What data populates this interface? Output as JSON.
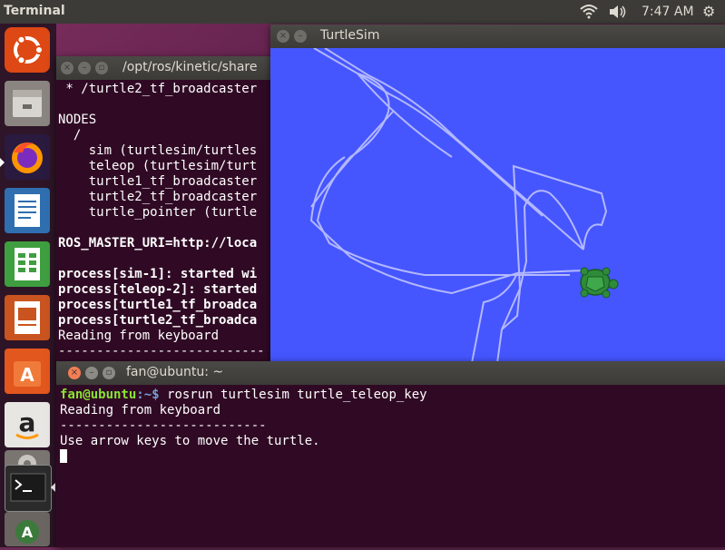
{
  "top_panel": {
    "app_title": "Terminal",
    "time": "7:47 AM",
    "indicators": [
      "wifi-icon",
      "volume-icon",
      "gear-icon"
    ]
  },
  "launcher": {
    "items": [
      "ubuntu-dash-icon",
      "files-icon",
      "firefox-icon",
      "writer-icon",
      "calc-icon",
      "impress-icon",
      "software-center-icon",
      "amazon-icon",
      "system-settings-icon",
      "terminal-icon",
      "software-updater-icon"
    ]
  },
  "terminal1": {
    "title": "/opt/ros/kinetic/share",
    "lines": [
      " * /turtle2_tf_broadcaster",
      "",
      "NODES",
      "  /",
      "    sim (turtlesim/turtles",
      "    teleop (turtlesim/turt",
      "    turtle1_tf_broadcaster",
      "    turtle2_tf_broadcaster",
      "    turtle_pointer (turtle",
      "",
      "ROS_MASTER_URI=http://loca",
      "",
      "process[sim-1]: started wi",
      "process[teleop-2]: started",
      "process[turtle1_tf_broadca",
      "process[turtle2_tf_broadca",
      "Reading from keyboard",
      "---------------------------"
    ],
    "bold_lines": [
      10,
      12,
      13,
      14,
      15
    ]
  },
  "turtlesim": {
    "title": "TurtleSim",
    "background": "#4556ff",
    "path_color": "#b3b8ff",
    "turtle_color": "#2e8b3a"
  },
  "terminal2": {
    "title": "fan@ubuntu: ~",
    "prompt_user": "fan@ubuntu",
    "prompt_sep": ":~$ ",
    "command": "rosrun turtlesim turtle_teleop_key",
    "line2": "Reading from keyboard",
    "line3": "---------------------------",
    "line4": "Use arrow keys to move the turtle."
  }
}
